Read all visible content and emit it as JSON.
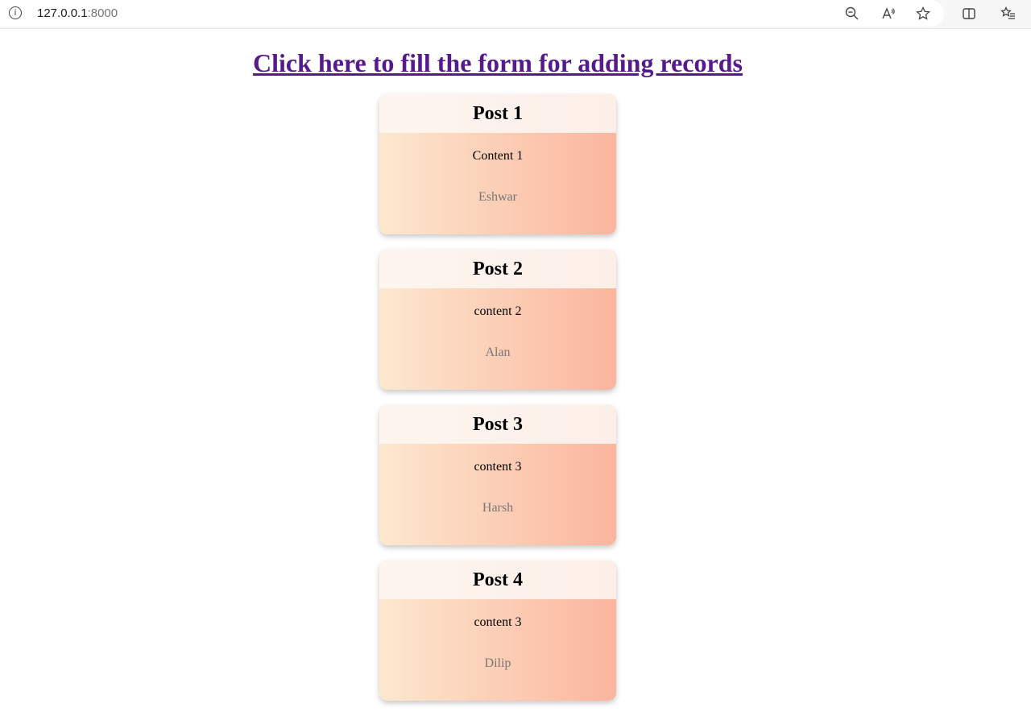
{
  "browser": {
    "url_host": "127.0.0.1",
    "url_port": ":8000",
    "icons": [
      "info-icon",
      "zoom-out-icon",
      "read-aloud-icon",
      "favorite-star-icon",
      "split-screen-icon",
      "favorites-list-icon"
    ]
  },
  "page": {
    "link_text": "Click here to fill the form for adding records",
    "link_color": "#551a8b"
  },
  "posts": [
    {
      "title": "Post 1",
      "content": "Content 1",
      "author": "Eshwar"
    },
    {
      "title": "Post 2",
      "content": "content 2",
      "author": "Alan"
    },
    {
      "title": "Post 3",
      "content": "content 3",
      "author": "Harsh"
    },
    {
      "title": "Post 4",
      "content": "content 3",
      "author": "Dilip"
    }
  ],
  "colors": {
    "card_gradient_start": "#fde8cf",
    "card_gradient_end": "#fbb59e",
    "author_text": "#777777"
  }
}
